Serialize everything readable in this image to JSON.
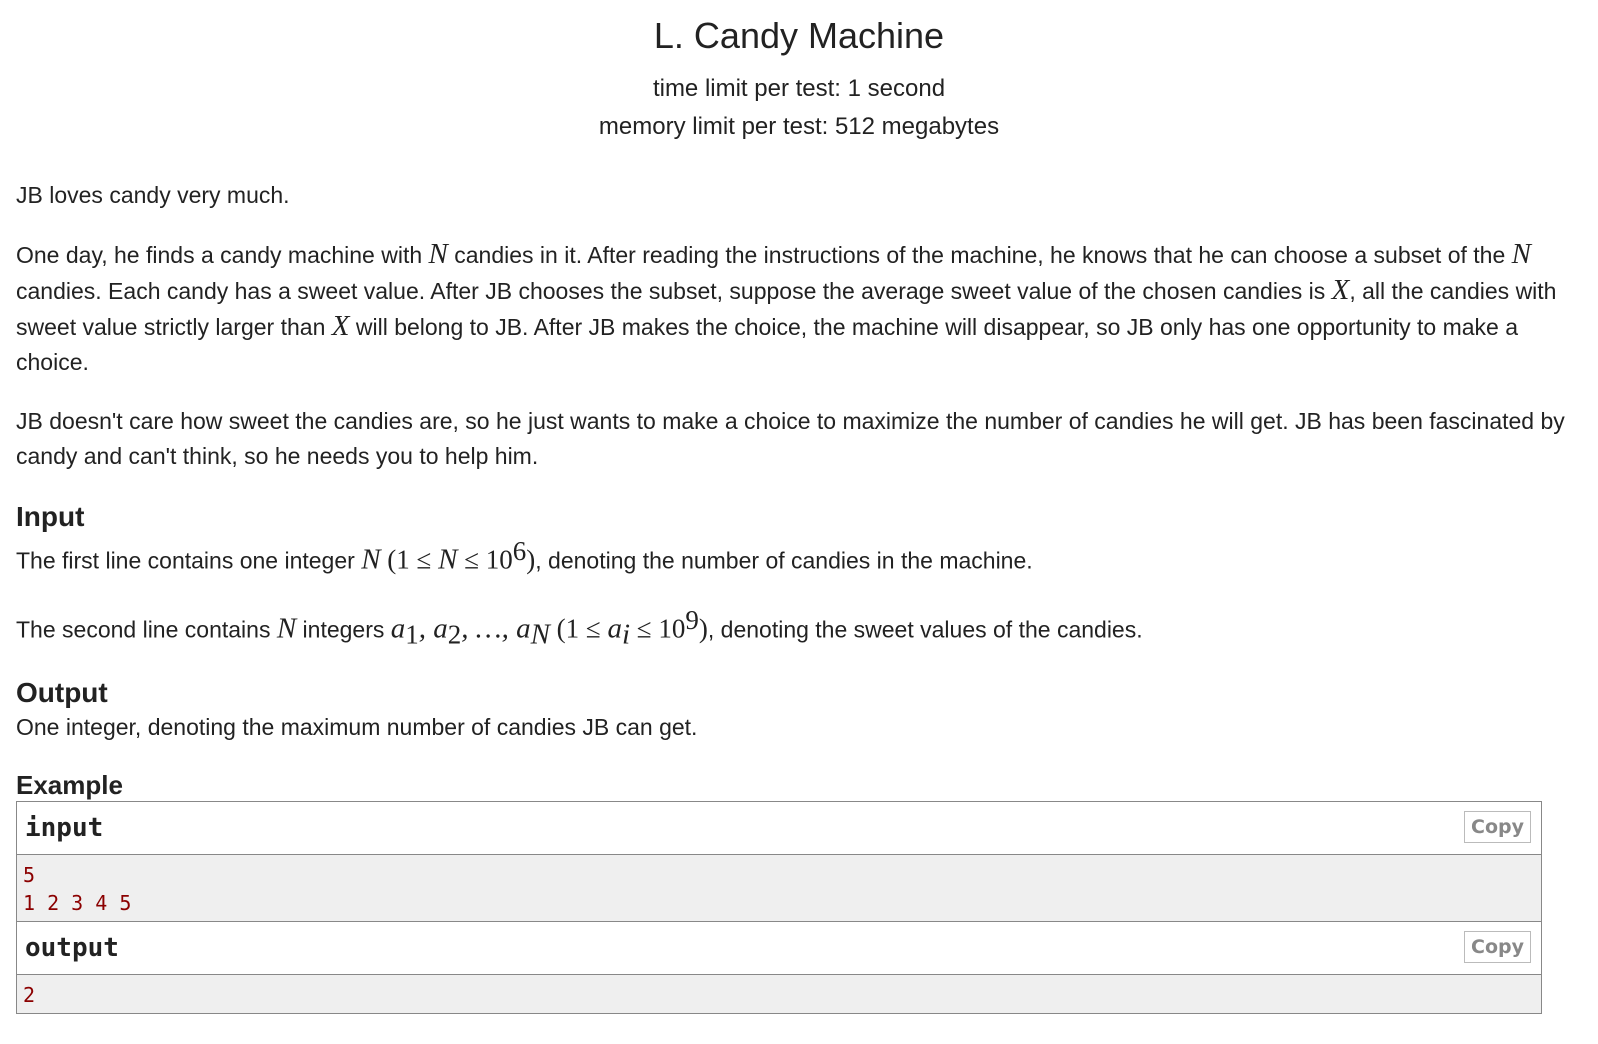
{
  "problem": {
    "title": "L. Candy Machine",
    "time_limit": "time limit per test: 1 second",
    "memory_limit": "memory limit per test: 512 megabytes"
  },
  "statement": {
    "p1": "JB loves candy very much.",
    "p2": {
      "a": "One day, he finds a candy machine with ",
      "N1": "N",
      "b": " candies in it. After reading the instructions of the machine, he knows that he can choose a subset of the ",
      "N2": "N",
      "c": " candies. Each candy has a sweet value. After JB chooses the subset, suppose the average sweet value of the chosen candies is ",
      "X1": "X",
      "d": ", all the candies with sweet value strictly larger than ",
      "X2": "X",
      "e": " will belong to JB. After JB makes the choice, the machine will disappear, so JB only has one opportunity to make a choice."
    },
    "p3": "JB doesn't care how sweet the candies are, so he just wants to make a choice to maximize the number of candies he will get. JB has been fascinated by candy and can't think, so he needs you to help him."
  },
  "input_section": {
    "title": "Input",
    "line1": {
      "a": "The first line contains one integer ",
      "N": "N",
      "open": " (1 ≤ ",
      "N2": "N",
      "le": " ≤ 10",
      "exp": "6",
      "close": ")",
      "b": ", denoting the number of candies in the machine."
    },
    "line2": {
      "a": "The second line contains ",
      "N": "N",
      "b": " integers ",
      "seq_a1": "a",
      "sub1": "1",
      "seq_a2": ", a",
      "sub2": "2",
      "seq_dots": ", …, a",
      "subN": "N",
      "open": " (1 ≤ ",
      "ai": "a",
      "subi": "i",
      "le": " ≤ 10",
      "exp": "9",
      "close": ")",
      "c": ", denoting the sweet values of the candies."
    }
  },
  "output_section": {
    "title": "Output",
    "text": "One integer, denoting the maximum number of candies JB can get."
  },
  "example": {
    "title": "Example",
    "input_label": "input",
    "output_label": "output",
    "copy_label": "Copy",
    "input_lines": [
      "5",
      "1 2 3 4 5"
    ],
    "output_lines": [
      "2"
    ]
  }
}
